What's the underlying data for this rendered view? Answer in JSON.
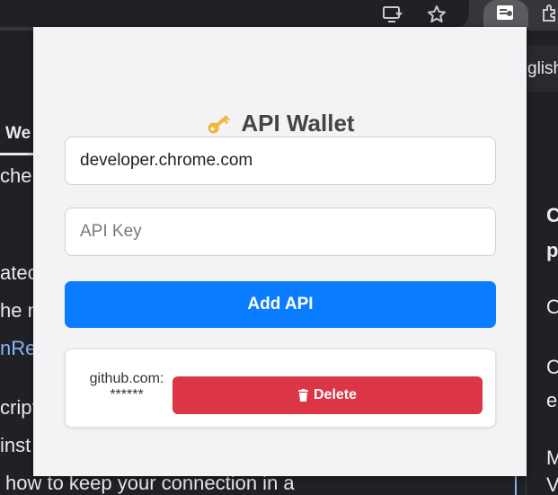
{
  "background_page": {
    "tab_label": "We",
    "left_lines": [
      "che",
      "atec",
      "he n",
      "nRe",
      "cript",
      "inst",
      "how to keep your connection in a"
    ],
    "right_lines": [
      "glish",
      "C",
      "p",
      "O",
      "C",
      "e",
      "M",
      "V"
    ]
  },
  "popup": {
    "title": "API Wallet",
    "title_icon": "key-icon",
    "site_input": {
      "value": "developer.chrome.com"
    },
    "key_input": {
      "placeholder": "API Key",
      "value": ""
    },
    "add_button_label": "Add API",
    "saved_entries": [
      {
        "site": "github.com:",
        "masked_key": "******",
        "delete_label": "Delete",
        "delete_icon": "trash-icon"
      }
    ]
  },
  "colors": {
    "accent": "#0a7cff",
    "danger": "#dc3545",
    "popup_bg": "#f3f3f5"
  }
}
